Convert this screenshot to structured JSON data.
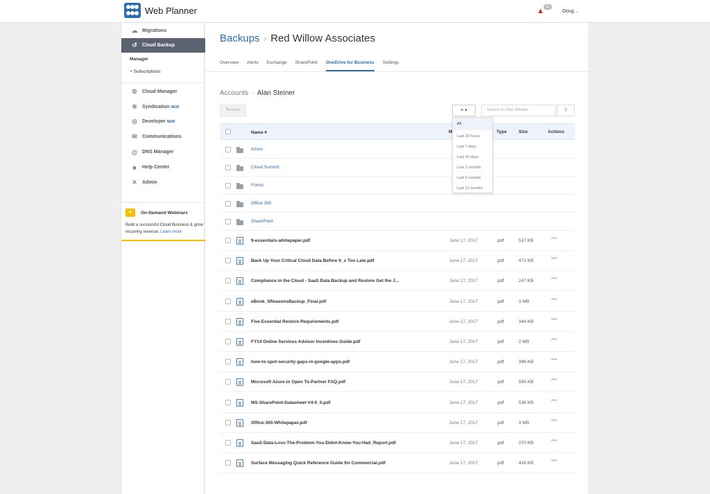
{
  "app": {
    "title": "Web Planner",
    "notification_count": "15",
    "user": "Doug"
  },
  "sidebar": {
    "top_items": [
      {
        "label": "Migrations",
        "icon": "cloud-icon"
      },
      {
        "label": "Cloud Backup",
        "icon": "history-icon",
        "active": true
      }
    ],
    "sub_items": [
      {
        "label": "Manager"
      },
      {
        "label": "+ Subscriptions"
      }
    ],
    "items": [
      {
        "label": "Cloud Manager",
        "icon": "gear-icon"
      },
      {
        "label": "Syndication",
        "icon": "syndication-icon",
        "badge": "NEW"
      },
      {
        "label": "Developer",
        "icon": "code-icon",
        "badge": "NEW"
      },
      {
        "label": "Communications",
        "icon": "envelope-icon"
      },
      {
        "label": "DNS Manager",
        "icon": "at-icon"
      },
      {
        "label": "Help Center",
        "icon": "book-icon"
      },
      {
        "label": "Admin",
        "icon": "tools-icon"
      }
    ],
    "webinar": {
      "title": "On-Demand Webinars",
      "text": "Build a successful Cloud Business & grow recurring revenue.",
      "link": "Learn more"
    }
  },
  "header": {
    "breadcrumb": "Backups",
    "title": "Red Willow Associates"
  },
  "tabs": [
    {
      "label": "Overview"
    },
    {
      "label": "Alerts"
    },
    {
      "label": "Exchange"
    },
    {
      "label": "SharePoint"
    },
    {
      "label": "OneDrive for Business",
      "active": true
    },
    {
      "label": "Settings"
    }
  ],
  "accounts": {
    "breadcrumb": "Accounts",
    "name": "Alan Steiner"
  },
  "toolbar": {
    "restore_label": "Restore",
    "search_placeholder": "Search in Alan Steiner"
  },
  "table": {
    "columns": {
      "name": "Name",
      "modified": "M",
      "type": "Type",
      "size": "Size",
      "actions": "Actions"
    },
    "folders": [
      "Azure",
      "Cloud Summit",
      "Forms",
      "Office 365",
      "SharePoint"
    ],
    "files": [
      {
        "name": "9-essentials-whitepaper.pdf",
        "date": "June 17, 2017",
        "type": ".pdf",
        "size": "517 KB"
      },
      {
        "name": "Back Up Your Critical Cloud Data Before It_s Too Late.pdf",
        "date": "June 17, 2017",
        "type": ".pdf",
        "size": "471 KB"
      },
      {
        "name": "Compliance in the Cloud - SaaS Data Backup and Restore Get the J...",
        "date": "June 17, 2017",
        "type": ".pdf",
        "size": "247 KB"
      },
      {
        "name": "eBook_5ReasonsBackup_Final.pdf",
        "date": "June 17, 2017",
        "type": ".pdf",
        "size": "3 MB"
      },
      {
        "name": "Five Essential Restore Requirements.pdf",
        "date": "June 17, 2017",
        "type": ".pdf",
        "size": "344 KB"
      },
      {
        "name": "FY14 Online Services Advisor Incentives Guide.pdf",
        "date": "June 17, 2017",
        "type": ".pdf",
        "size": "2 MB"
      },
      {
        "name": "how-to-spot-security-gaps-in-google-apps.pdf",
        "date": "June 17, 2017",
        "type": ".pdf",
        "size": "396 KB"
      },
      {
        "name": "Microsoft Azure in Open To-Partner FAQ.pdf",
        "date": "June 17, 2017",
        "type": ".pdf",
        "size": "599 KB"
      },
      {
        "name": "MS-SharePoint-Datasheet-V4-0_0.pdf",
        "date": "June 17, 2017",
        "type": ".pdf",
        "size": "536 KB"
      },
      {
        "name": "Office-365-Whitepaper.pdf",
        "date": "June 17, 2017",
        "type": ".pdf",
        "size": "3 MB"
      },
      {
        "name": "SaaS-Data-Loss-The-Problem-You-Didnt-Know-You-Had_Report.pdf",
        "date": "June 17, 2017",
        "type": ".pdf",
        "size": "270 KB"
      },
      {
        "name": "Surface Messaging Quick Reference Guide for Commercial.pdf",
        "date": "June 17, 2017",
        "type": ".pdf",
        "size": "416 KB"
      }
    ],
    "actions_label": "***"
  },
  "filter_dropdown": {
    "options": [
      "All",
      "Last 24 hours",
      "Last 7 days",
      "Last 30 days",
      "Last 3 months",
      "Last 6 months",
      "Last 12 months"
    ],
    "selected": "All"
  },
  "colors": {
    "accent": "#2b6cb0",
    "sidebar_active": "#5b6370",
    "notification": "#e02424",
    "webinar": "#f2c200"
  }
}
